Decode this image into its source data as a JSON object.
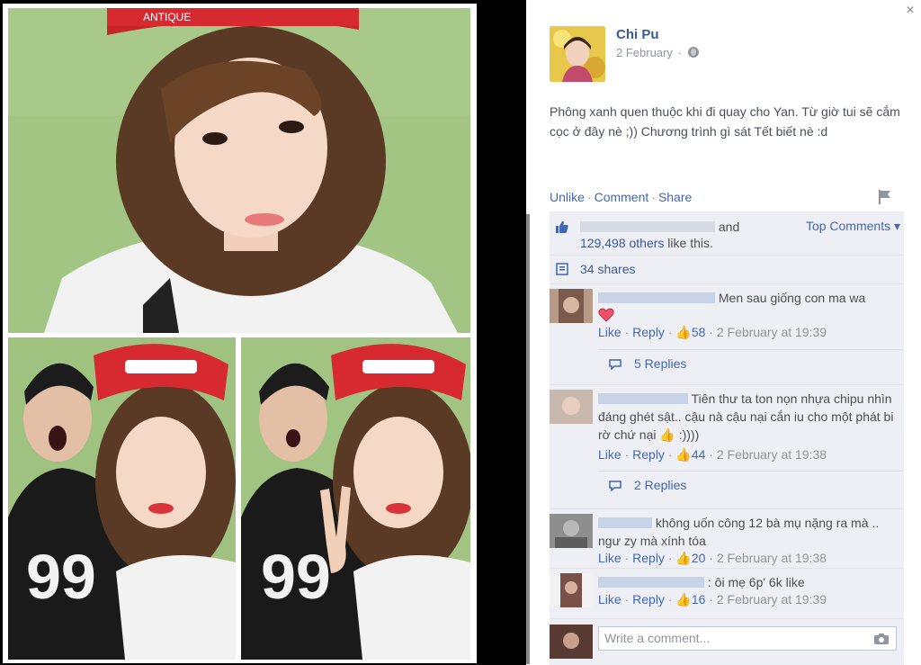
{
  "post": {
    "author": "Chi Pu",
    "date": "2 February",
    "text": "Phông xanh quen thuộc khi đi quay cho Yan. Từ giờ tui sẽ cắm cọc ở đây nè ;)) Chương trình gì sát Tết biết nè :d",
    "privacy_icon": "globe-icon"
  },
  "actions": {
    "unlike": "Unlike",
    "comment": "Comment",
    "share": "Share"
  },
  "likes": {
    "and_text": "and",
    "others_count": "129,498 others",
    "like_suffix": "like this.",
    "top_comments": "Top Comments ▾"
  },
  "shares": {
    "label": "34 shares"
  },
  "comments": [
    {
      "text": "Men sau giống con ma wa",
      "like": "Like",
      "reply": "Reply",
      "likes": "58",
      "time": "2 February at 19:39",
      "replies": "5 Replies"
    },
    {
      "text": "Tiên thư ta ton nọn nhựa chipu nhìn đáng ghét sật.. cậu nà cậu nại cắn iu cho một phát bi rờ chứ nại",
      "text_tail": ":))))",
      "like": "Like",
      "reply": "Reply",
      "likes": "44",
      "time": "2 February at 19:38",
      "replies": "2 Replies"
    },
    {
      "text": "không uốn công 12 bà mụ nặng ra mà .. ngư zy mà xính tóa",
      "like": "Like",
      "reply": "Reply",
      "likes": "20",
      "time": "2 February at 19:38"
    },
    {
      "text": ": ôi mẹ 6p' 6k like",
      "like": "Like",
      "reply": "Reply",
      "likes": "16",
      "time": "2 February at 19:39"
    }
  ],
  "compose": {
    "placeholder": "Write a comment..."
  },
  "close": "×",
  "photo_1_cap_text": "ANTIQUE",
  "photo_2_shirt_text": "99",
  "photo_3_shirt_text": "99",
  "colors": {
    "link": "#3b5998",
    "action": "#4267b2",
    "muted": "#90949c",
    "ufi_bg": "#edeff4",
    "screen_green": "#9dc47c"
  }
}
